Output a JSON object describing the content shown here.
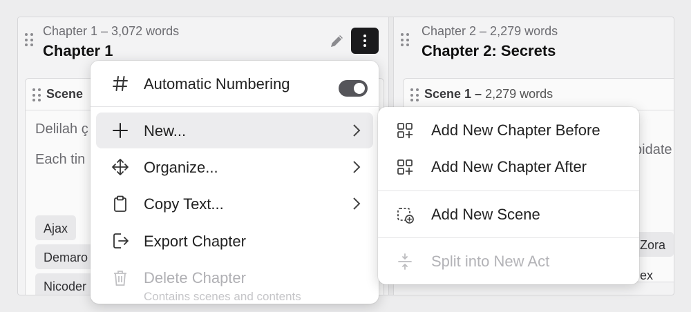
{
  "columns": [
    {
      "subtitle": "Chapter 1 – 3,072 words",
      "title": "Chapter 1",
      "scene": {
        "label": "Scene",
        "text_lines": [
          "Delilah ç",
          "Each tin"
        ],
        "chips": [
          "Ajax",
          "Demaro",
          "Nicoder"
        ]
      }
    },
    {
      "subtitle": "Chapter 2 – 2,279 words",
      "title": "Chapter 2: Secrets",
      "scene": {
        "label": "Scene 1 –",
        "words": "2,279 words",
        "text_lines": [
          "pidate",
          "r"
        ],
        "chips": [
          "Zora",
          "ex"
        ]
      }
    }
  ],
  "menu": {
    "items": [
      {
        "label": "Automatic Numbering",
        "icon": "hash-icon",
        "toggle_on": true
      },
      {
        "label": "New...",
        "icon": "plus-icon",
        "submenu": true
      },
      {
        "label": "Organize...",
        "icon": "move-icon",
        "submenu": true
      },
      {
        "label": "Copy Text...",
        "icon": "clipboard-icon",
        "submenu": true
      },
      {
        "label": "Export Chapter",
        "icon": "export-icon"
      },
      {
        "label": "Delete Chapter",
        "icon": "trash-icon",
        "disabled": true
      }
    ],
    "delete_subtext": "Contains scenes and contents"
  },
  "submenu": {
    "items": [
      {
        "label": "Add New Chapter Before",
        "icon": "grid-plus-icon"
      },
      {
        "label": "Add New Chapter After",
        "icon": "grid-plus-icon"
      },
      {
        "label": "Add New Scene",
        "icon": "scene-plus-icon"
      },
      {
        "label": "Split into New Act",
        "icon": "split-icon",
        "disabled": true
      }
    ]
  }
}
